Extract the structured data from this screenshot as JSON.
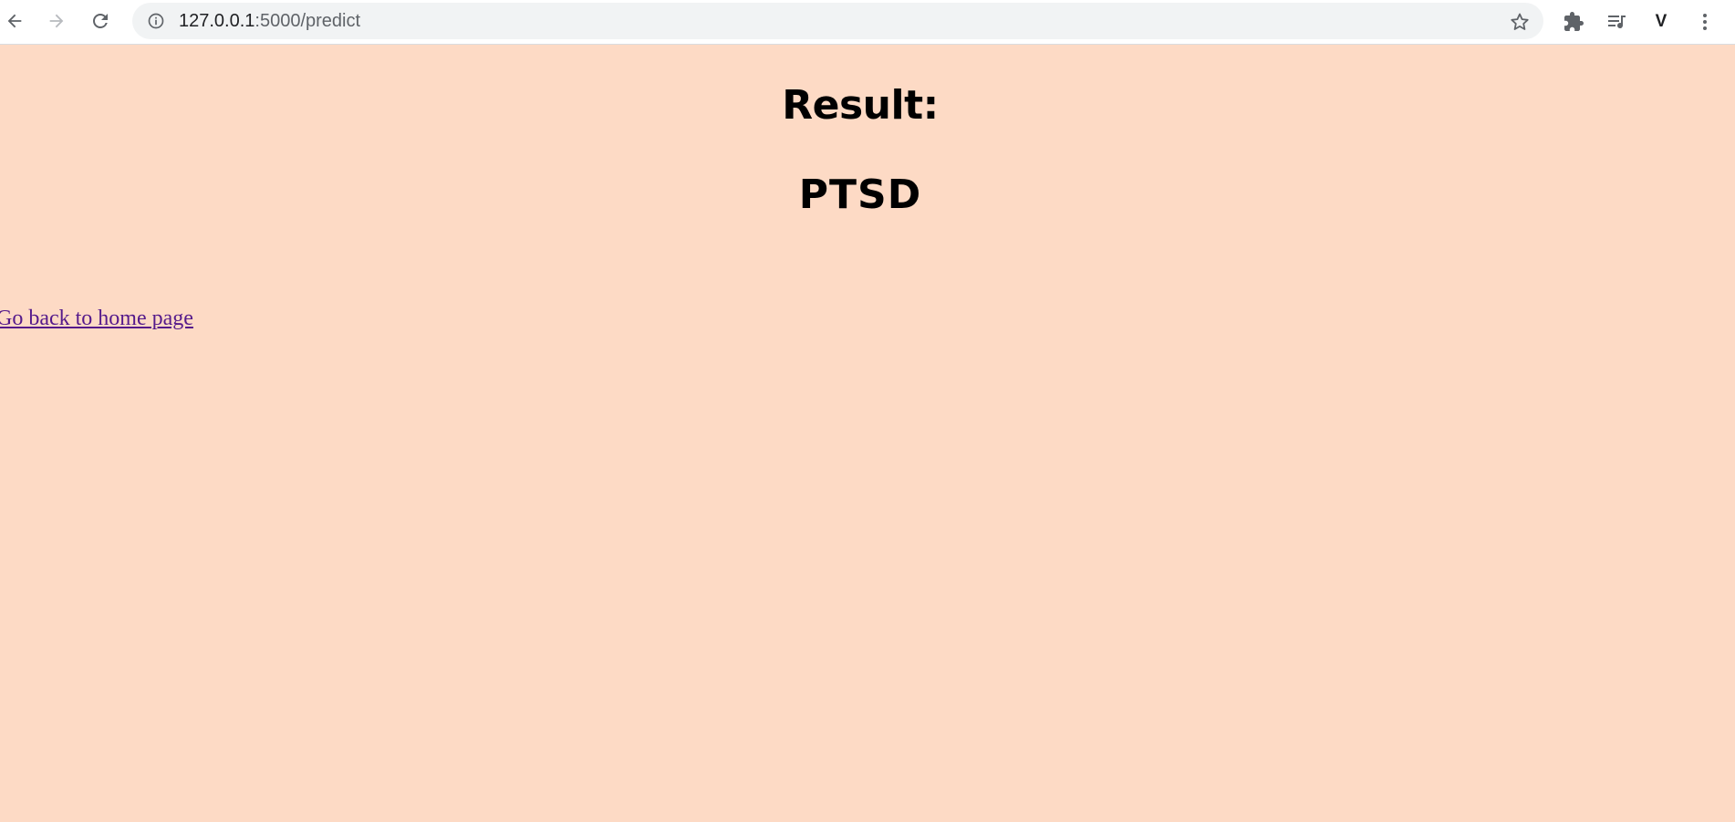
{
  "browser": {
    "url_host": "127.0.0.1",
    "url_path": ":5000/predict",
    "profile_initial": "V",
    "icons": [
      "back-arrow-icon",
      "forward-arrow-icon",
      "reload-icon",
      "info-icon",
      "star-icon",
      "extensions-puzzle-icon",
      "media-queue-icon",
      "more-vert-icon"
    ]
  },
  "page": {
    "background_color": "#fddac5",
    "heading": "Result:",
    "result_value": "PTSD",
    "home_link_label": "Go back to home page",
    "link_color": "#551a8b"
  }
}
